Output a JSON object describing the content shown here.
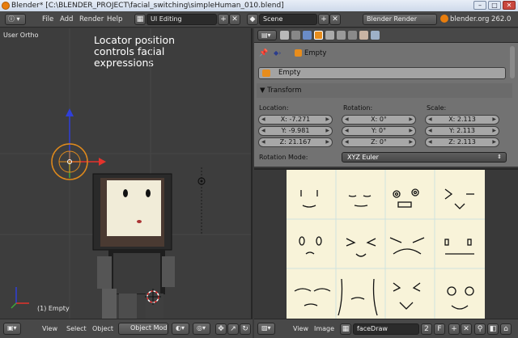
{
  "window": {
    "title": "Blender* [C:\\BLENDER_PROJECT\\facial_switching\\simpleHuman_010.blend]",
    "minimize": "–",
    "maximize": "□",
    "close": "✕"
  },
  "info_header": {
    "menus": [
      "File",
      "Add",
      "Render",
      "Help"
    ],
    "screen_layout": "UI Editing",
    "scene": "Scene",
    "render_engine": "Blender Render",
    "version_stats": "blender.org 262.0"
  },
  "viewport": {
    "view_label": "User Ortho",
    "annotation": "Locator position\ncontrols facial\nexpressions",
    "object_label": "(1) Empty",
    "header": {
      "items": [
        "View",
        "Select",
        "Object"
      ],
      "mode": "Object Mode"
    }
  },
  "properties": {
    "breadcrumb_object": "Empty",
    "object_name": "Empty",
    "panel_title": "Transform",
    "location_label": "Location:",
    "rotation_label": "Rotation:",
    "scale_label": "Scale:",
    "location": [
      "X: -7.271",
      "Y: -9.981",
      "Z: 21.167"
    ],
    "rotation": [
      "X: 0°",
      "Y: 0°",
      "Z: 0°"
    ],
    "scale": [
      "X: 2.113",
      "Y: 2.113",
      "Z: 2.113"
    ],
    "rotation_mode_label": "Rotation Mode:",
    "rotation_mode_value": "XYZ Euler"
  },
  "image_editor": {
    "header": {
      "items": [
        "View",
        "Image"
      ],
      "image_name": "faceDraw",
      "users": "2",
      "fake_user": "F"
    }
  },
  "colors": {
    "accent_orange": "#e87d0d",
    "canvas": "#f8f3d9",
    "panel_grey": "#727272"
  }
}
